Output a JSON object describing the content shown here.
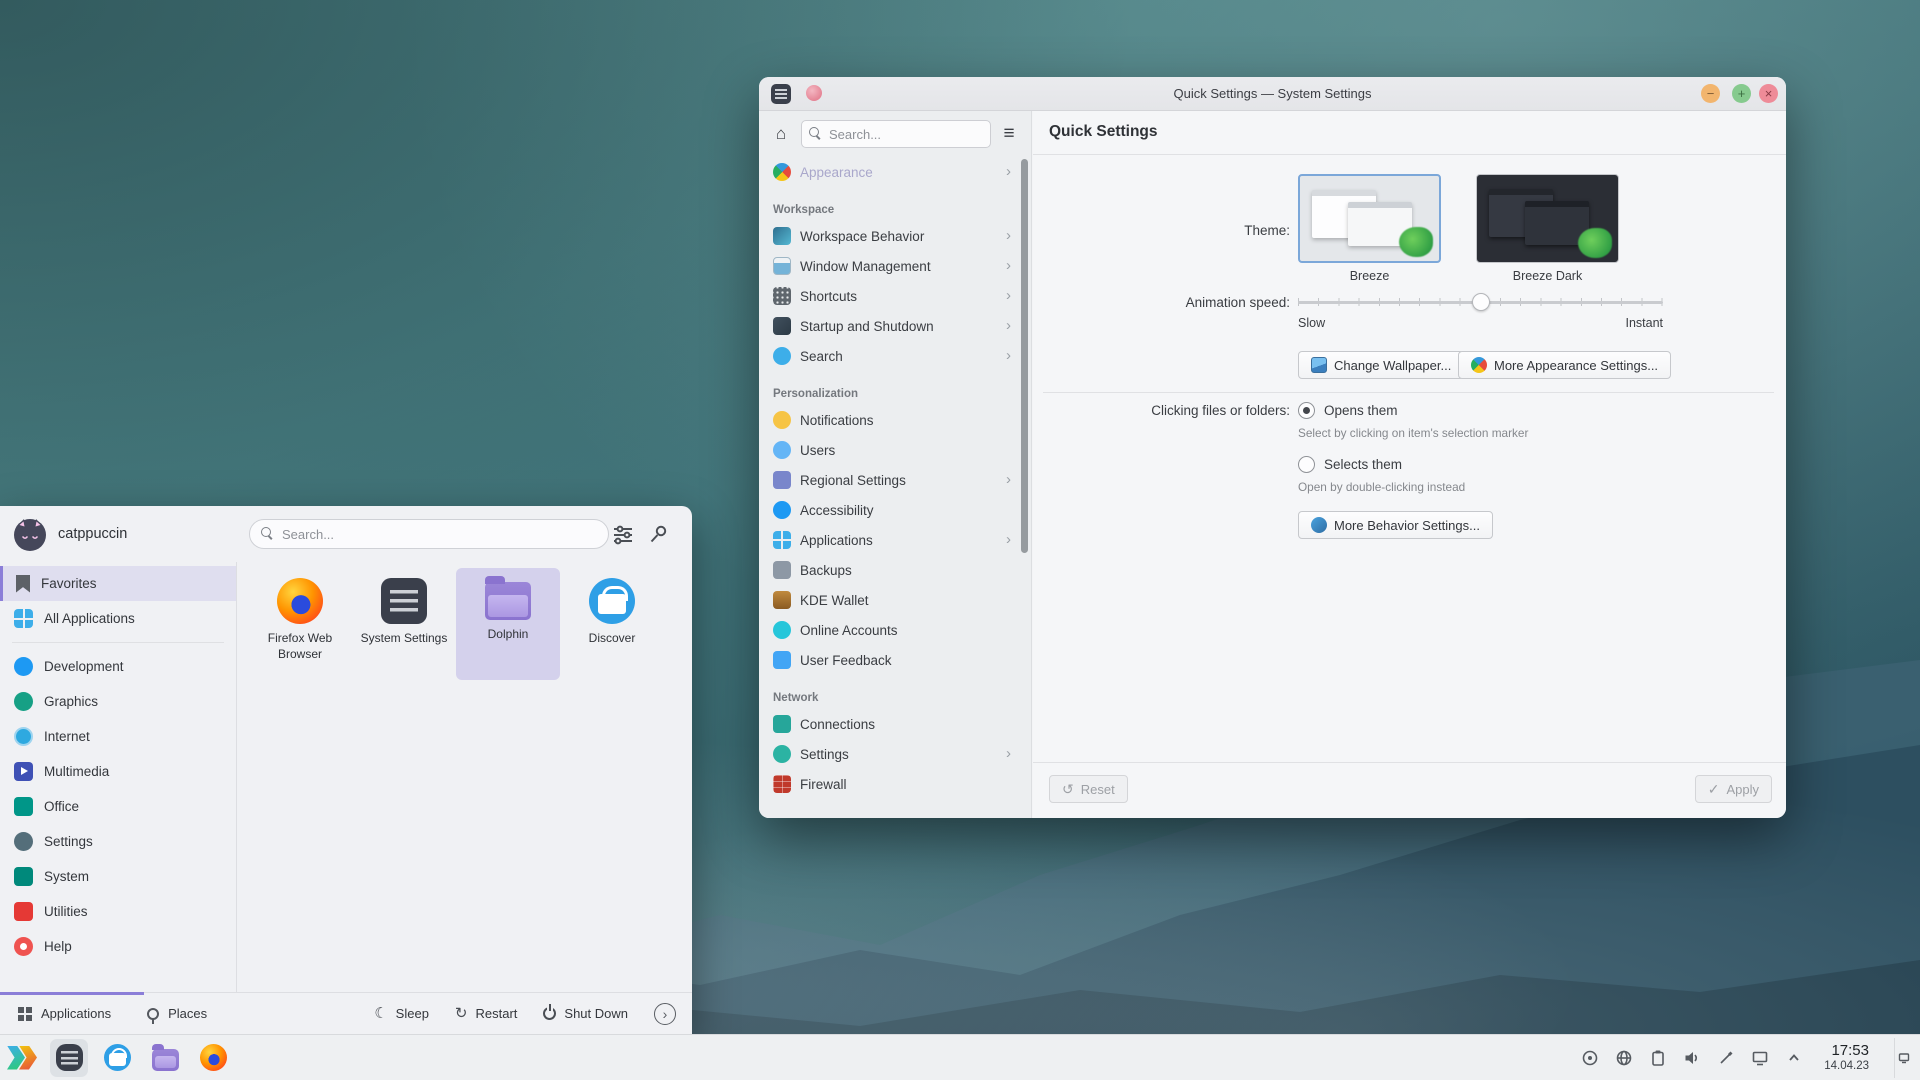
{
  "colors": {
    "accent_purple": "#8b7ed8",
    "selection_blue": "#7ba7d9",
    "titlebar_min": "#f2b56e",
    "titlebar_max": "#86ca8e",
    "titlebar_close": "#ee8b98"
  },
  "icons": {
    "home": "⌂",
    "hamburger": "≡",
    "chevron_right": "›",
    "minimize": "−",
    "maximize": "+",
    "close": "×",
    "reset": "↺",
    "apply": "✓",
    "sleep": "☾",
    "restart": "↻"
  },
  "settings": {
    "title": "Quick Settings — System Settings",
    "search_placeholder": "Search...",
    "nav": [
      {
        "label": "Appearance"
      },
      {
        "label": "Workspace"
      },
      {
        "label": "Workspace Behavior"
      },
      {
        "label": "Window Management"
      },
      {
        "label": "Shortcuts"
      },
      {
        "label": "Startup and Shutdown"
      },
      {
        "label": "Search"
      },
      {
        "label": "Personalization"
      },
      {
        "label": "Notifications"
      },
      {
        "label": "Users"
      },
      {
        "label": "Regional Settings"
      },
      {
        "label": "Accessibility"
      },
      {
        "label": "Applications"
      },
      {
        "label": "Backups"
      },
      {
        "label": "KDE Wallet"
      },
      {
        "label": "Online Accounts"
      },
      {
        "label": "User Feedback"
      },
      {
        "label": "Network"
      },
      {
        "label": "Connections"
      },
      {
        "label": "Settings"
      },
      {
        "label": "Firewall"
      }
    ],
    "page": {
      "title": "Quick Settings",
      "theme_label": "Theme:",
      "themes": [
        {
          "name": "Breeze",
          "selected": true
        },
        {
          "name": "Breeze Dark",
          "selected": false
        }
      ],
      "animation_label": "Animation speed:",
      "slow": "Slow",
      "instant": "Instant",
      "change_wallpaper": "Change Wallpaper...",
      "more_appearance": "More Appearance Settings...",
      "click_label": "Clicking files or folders:",
      "opens_label": "Opens them",
      "opens_caption": "Select by clicking on item's selection marker",
      "selects_label": "Selects them",
      "selects_caption": "Open by double-clicking instead",
      "more_behavior": "More Behavior Settings...",
      "reset": "Reset",
      "apply": "Apply"
    }
  },
  "launcher": {
    "user": "catppuccin",
    "search_placeholder": "Search...",
    "categories": [
      "Favorites",
      "All Applications",
      "Development",
      "Graphics",
      "Internet",
      "Multimedia",
      "Office",
      "Settings",
      "System",
      "Utilities",
      "Help"
    ],
    "apps": [
      "Firefox Web Browser",
      "System Settings",
      "Dolphin",
      "Discover"
    ],
    "tabs": [
      "Applications",
      "Places"
    ],
    "power": [
      "Sleep",
      "Restart",
      "Shut Down"
    ]
  },
  "taskbar": {
    "time": "17:53",
    "date": "14.04.23"
  }
}
